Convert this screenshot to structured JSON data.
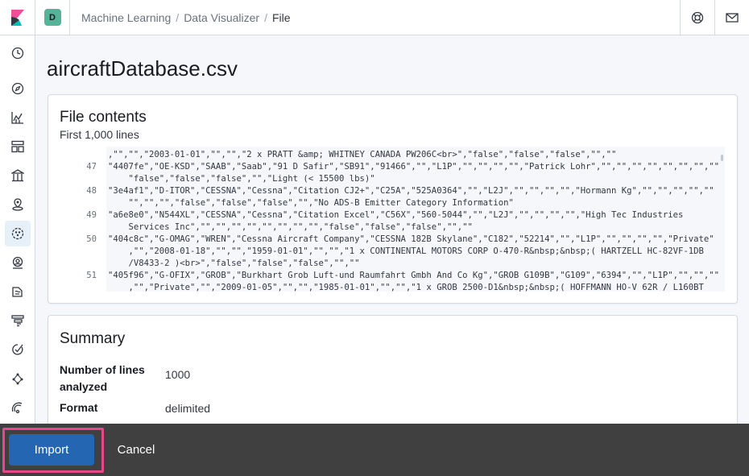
{
  "header": {
    "space_initial": "D",
    "breadcrumbs": [
      "Machine Learning",
      "Data Visualizer",
      "File"
    ],
    "separator": "/"
  },
  "nav": {
    "items": [
      "clock-icon",
      "compass-icon",
      "visualize-icon",
      "dashboard-icon",
      "canvas-icon",
      "maps-icon",
      "machine-learning-icon",
      "infrastructure-icon",
      "logs-icon",
      "apm-icon",
      "uptime-icon",
      "graph-icon",
      "monitoring-icon"
    ],
    "active": "machine-learning-icon"
  },
  "page": {
    "title": "aircraftDatabase.csv"
  },
  "file_contents": {
    "title": "File contents",
    "subtitle": "First 1,000 lines",
    "lines": [
      {
        "num": "",
        "text": ",\"\",\"\",\"2003-01-01\",\"\",\"\",\"2 x PRATT &amp; WHITNEY CANADA PW206C<br>\",\"false\",\"false\",\"false\",\"\",\"\""
      },
      {
        "num": "47",
        "text": "\"4407fe\",\"OE-KSD\",\"SAAB\",\"Saab\",\"91 D Safir\",\"SB91\",\"91466\",\"\",\"L1P\",\"\",\"\",\"\",\"\",\"Patrick Lohr\",\"\",\"\",\"\",\"\",\"\",\"\",\"\",\"\""
      },
      {
        "num": "",
        "text": "    \"false\",\"false\",\"false\",\"\",\"Light (< 15500 lbs)\""
      },
      {
        "num": "48",
        "text": "\"3e4af1\",\"D-ITOR\",\"CESSNA\",\"Cessna\",\"Citation CJ2+\",\"C25A\",\"525A0364\",\"\",\"L2J\",\"\",\"\",\"\",\"\",\"Hormann Kg\",\"\",\"\",\"\",\"\",\"\""
      },
      {
        "num": "",
        "text": "    \"\",\"\",\"\",\"false\",\"false\",\"false\",\"\",\"No ADS-B Emitter Category Information\""
      },
      {
        "num": "49",
        "text": "\"a6e8e0\",\"N544XL\",\"CESSNA\",\"Cessna\",\"Citation Excel\",\"C56X\",\"560-5044\",\"\",\"L2J\",\"\",\"\",\"\",\"\",\"High Tec Industries"
      },
      {
        "num": "",
        "text": "    Services Inc\",\"\",\"\",\"\",\"\",\"\",\"\",\"\",\"\",\"false\",\"false\",\"false\",\"\",\"\""
      },
      {
        "num": "50",
        "text": "\"404c8c\",\"G-OMAG\",\"WREN\",\"Cessna Aircraft Company\",\"CESSNA 182B Skylane\",\"C182\",\"52214\",\"\",\"L1P\",\"\",\"\",\"\",\"\",\"Private\""
      },
      {
        "num": "",
        "text": "    ,\"\",\"2008-01-18\",\"\",\"\",\"1959-01-01\",\"\",\"\",\"1 x CONTINENTAL MOTORS CORP O-470-R&nbsp;&nbsp;( HARTZELL HC-82VF-1DB"
      },
      {
        "num": "",
        "text": "    /V8433-2 )<br>\",\"false\",\"false\",\"false\",\"\",\"\""
      },
      {
        "num": "51",
        "text": "\"405f96\",\"G-OFIX\",\"GROB\",\"Burkhart Grob Luft-und Raumfahrt Gmbh And Co Kg\",\"GROB G109B\",\"G109\",\"6394\",\"\",\"L1P\",\"\",\"\",\"\""
      },
      {
        "num": "",
        "text": "    ,\"\",\"Private\",\"\",\"2009-01-05\",\"\",\"\",\"1985-01-01\",\"\",\"\",\"1 x GROB 2500-D1&nbsp;&nbsp;( HOFFMANN HO-V 62R / L160BT"
      }
    ]
  },
  "summary": {
    "title": "Summary",
    "lines_label": "Number of lines analyzed",
    "lines_value": "1000",
    "format_label": "Format",
    "format_value": "delimited"
  },
  "actions": {
    "import_label": "Import",
    "cancel_label": "Cancel"
  },
  "colors": {
    "import_button": "#2466b2",
    "highlight_outline": "#e8488b",
    "bottom_bar": "#404040",
    "space_badge": "#54b399"
  }
}
